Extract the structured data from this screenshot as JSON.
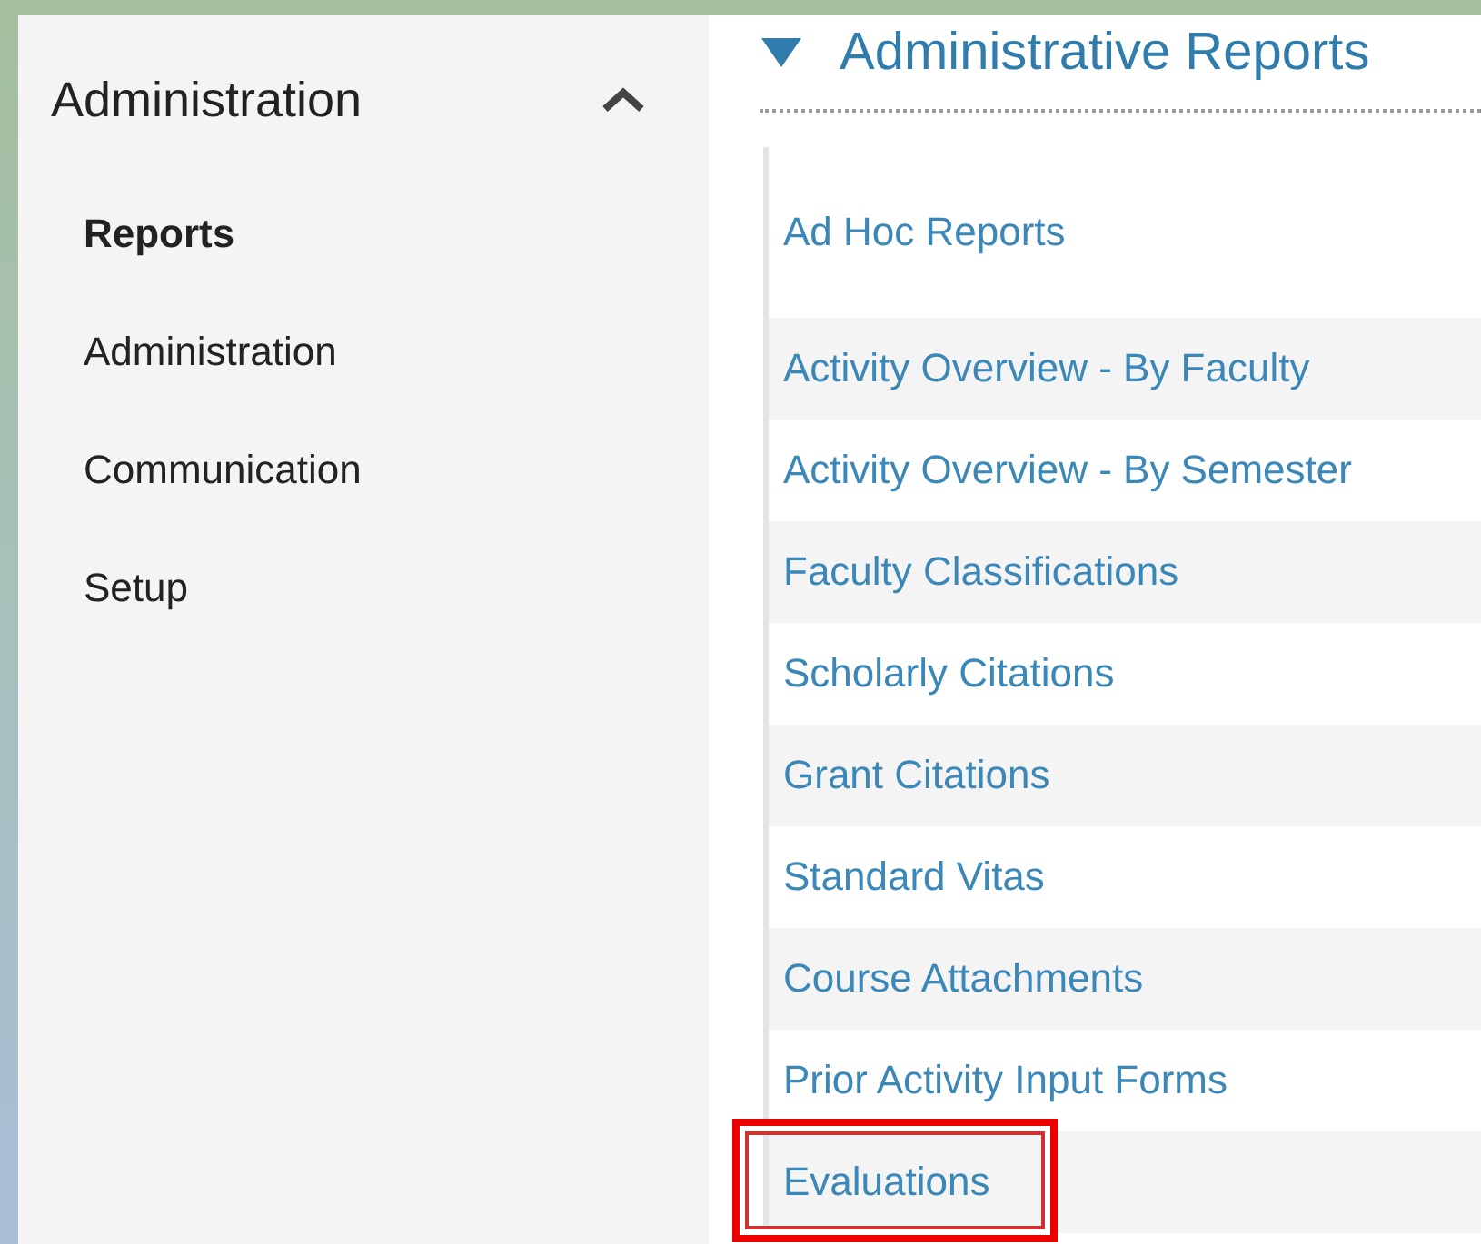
{
  "sidebar": {
    "title": "Administration",
    "expanded": true,
    "items": [
      {
        "label": "Reports",
        "selected": true
      },
      {
        "label": "Administration",
        "selected": false
      },
      {
        "label": "Communication",
        "selected": false
      },
      {
        "label": "Setup",
        "selected": false
      }
    ]
  },
  "section": {
    "title": "Administrative Reports",
    "expanded": true,
    "items": [
      {
        "label": "Ad Hoc Reports",
        "highlighted": false
      },
      {
        "label": "Activity Overview - By Faculty",
        "highlighted": false
      },
      {
        "label": "Activity Overview - By Semester",
        "highlighted": false
      },
      {
        "label": "Faculty Classifications",
        "highlighted": false
      },
      {
        "label": "Scholarly Citations",
        "highlighted": false
      },
      {
        "label": "Grant Citations",
        "highlighted": false
      },
      {
        "label": "Standard Vitas",
        "highlighted": false
      },
      {
        "label": "Course Attachments",
        "highlighted": false
      },
      {
        "label": "Prior Activity Input Forms",
        "highlighted": false
      },
      {
        "label": "Evaluations",
        "highlighted": true
      }
    ]
  }
}
